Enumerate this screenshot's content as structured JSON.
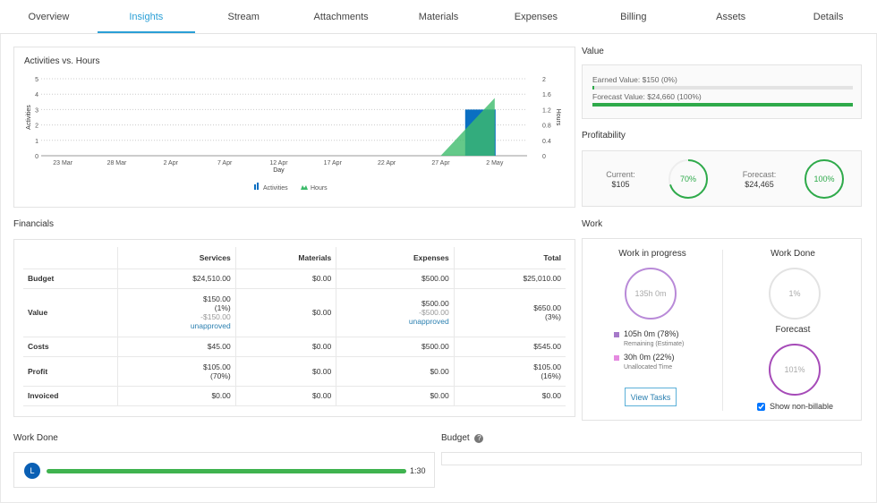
{
  "tabs": [
    "Overview",
    "Insights",
    "Stream",
    "Attachments",
    "Materials",
    "Expenses",
    "Billing",
    "Assets",
    "Details"
  ],
  "active_tab": "Insights",
  "chart_data": {
    "type": "bar+area",
    "title": "Activities vs. Hours",
    "xlabel": "Day",
    "ylabel": "Activities",
    "y2label": "Hours",
    "x_ticks": [
      "23 Mar",
      "28 Mar",
      "2 Apr",
      "7 Apr",
      "12 Apr",
      "17 Apr",
      "22 Apr",
      "27 Apr",
      "2 May"
    ],
    "ylim": [
      0,
      5
    ],
    "y_ticks": [
      "0",
      "1",
      "2",
      "3",
      "4",
      "5"
    ],
    "y2lim": [
      0,
      2
    ],
    "y2_ticks": [
      "0",
      "0.4",
      "0.8",
      "1.2",
      "1.6",
      "2"
    ],
    "series": [
      {
        "name": "Activities",
        "type": "bar",
        "color": "#0a6fc2",
        "points": [
          {
            "x": "2 May",
            "y": 3
          }
        ]
      },
      {
        "name": "Hours",
        "type": "area",
        "color": "#3dbb6b",
        "points": [
          {
            "x": "27 Apr",
            "y": 0
          },
          {
            "x": "2 May",
            "y": 1.5
          }
        ]
      }
    ],
    "grid": true,
    "legend": "bottom"
  },
  "value": {
    "title": "Value",
    "earned": "Earned Value: $150 (0%)",
    "earned_pct": 0.6,
    "forecast": "Forecast Value: $24,660 (100%)",
    "forecast_pct": 100
  },
  "profitability": {
    "title": "Profitability",
    "current_label": "Current:",
    "current": "$105",
    "current_pct": "70%",
    "current_pct_value": 70,
    "forecast_label": "Forecast:",
    "forecast": "$24,465",
    "forecast_pct": "100%",
    "forecast_pct_value": 100
  },
  "financials": {
    "title": "Financials",
    "columns": [
      "",
      "Services",
      "Materials",
      "Expenses",
      "Total"
    ],
    "rows": [
      {
        "label": "Budget",
        "cells": [
          [
            "$24,510.00"
          ],
          [
            "$0.00"
          ],
          [
            "$500.00"
          ],
          [
            "$25,010.00"
          ]
        ]
      },
      {
        "label": "Value",
        "cells": [
          [
            "$150.00",
            "(1%)",
            "-$150.00",
            "unapproved"
          ],
          [
            "$0.00"
          ],
          [
            "$500.00",
            "-$500.00",
            "unapproved"
          ],
          [
            "$650.00",
            "(3%)"
          ]
        ]
      },
      {
        "label": "Costs",
        "cells": [
          [
            "$45.00"
          ],
          [
            "$0.00"
          ],
          [
            "$500.00"
          ],
          [
            "$545.00"
          ]
        ]
      },
      {
        "label": "Profit",
        "cells": [
          [
            "$105.00",
            "(70%)"
          ],
          [
            "$0.00"
          ],
          [
            "$0.00"
          ],
          [
            "$105.00",
            "(16%)"
          ]
        ]
      },
      {
        "label": "Invoiced",
        "cells": [
          [
            "$0.00"
          ],
          [
            "$0.00"
          ],
          [
            "$0.00"
          ],
          [
            "$0.00"
          ]
        ]
      }
    ]
  },
  "work": {
    "title": "Work",
    "wip_title": "Work in progress",
    "wip_total": "135h 0m",
    "remaining": "105h 0m (78%)",
    "remaining_label": "Remaining (Estimate)",
    "unallocated": "30h 0m (22%)",
    "unallocated_label": "Unallocated Time",
    "view_tasks": "View Tasks",
    "done_title": "Work Done",
    "done_pct": "1%",
    "forecast_title": "Forecast",
    "forecast_pct": "101%",
    "show_nonbillable": "Show non-billable",
    "show_nonbillable_checked": true
  },
  "work_done": {
    "title": "Work Done",
    "avatar": "L",
    "time": "1:30",
    "progress_pct": 100
  },
  "budget": {
    "title": "Budget",
    "help_icon": "question-circle-icon"
  }
}
